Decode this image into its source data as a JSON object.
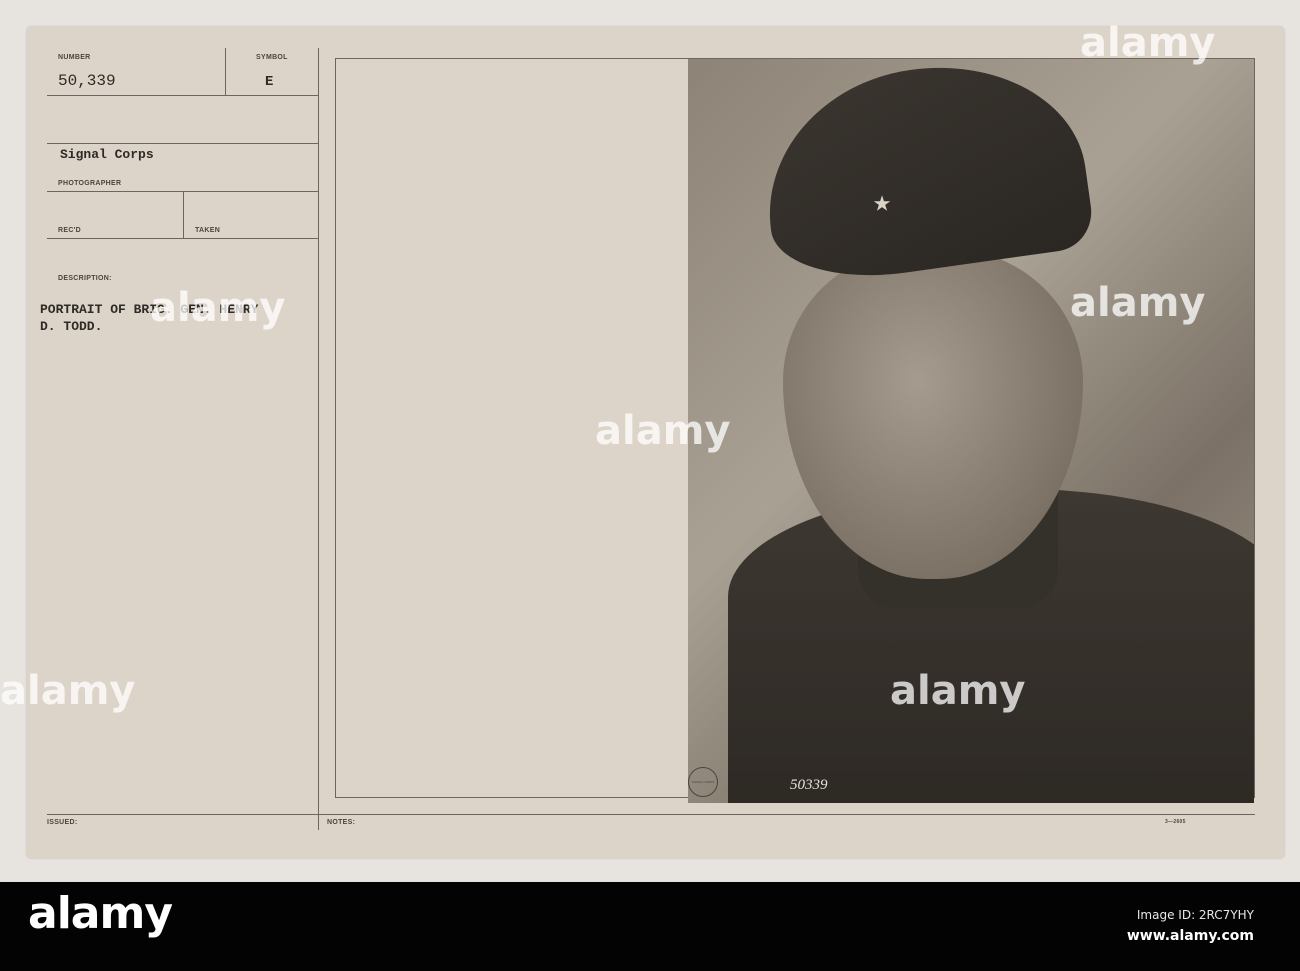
{
  "card": {
    "number_label": "NUMBER",
    "number_value": "50,339",
    "symbol_label": "SYMBOL",
    "symbol_value": "E",
    "photographer_value": "Signal Corps",
    "photographer_label": "PHOTOGRAPHER",
    "recd_label": "REC'D",
    "taken_label": "TAKEN",
    "description_label": "DESCRIPTION:",
    "description_line1": "PORTRAIT OF BRIG. GEN. HENRY",
    "description_line2": "D. TODD.",
    "issued_label": "ISSUED:",
    "notes_label": "NOTES:",
    "form_number": "3—2605"
  },
  "photo": {
    "negative_number": "50339",
    "stamp_text": "SIGNAL CORPS"
  },
  "watermark": {
    "text": "alamy",
    "letter": "a"
  },
  "footer": {
    "logo": "alamy",
    "image_id": "Image ID: 2RC7YHY",
    "site": "www.alamy.com"
  }
}
